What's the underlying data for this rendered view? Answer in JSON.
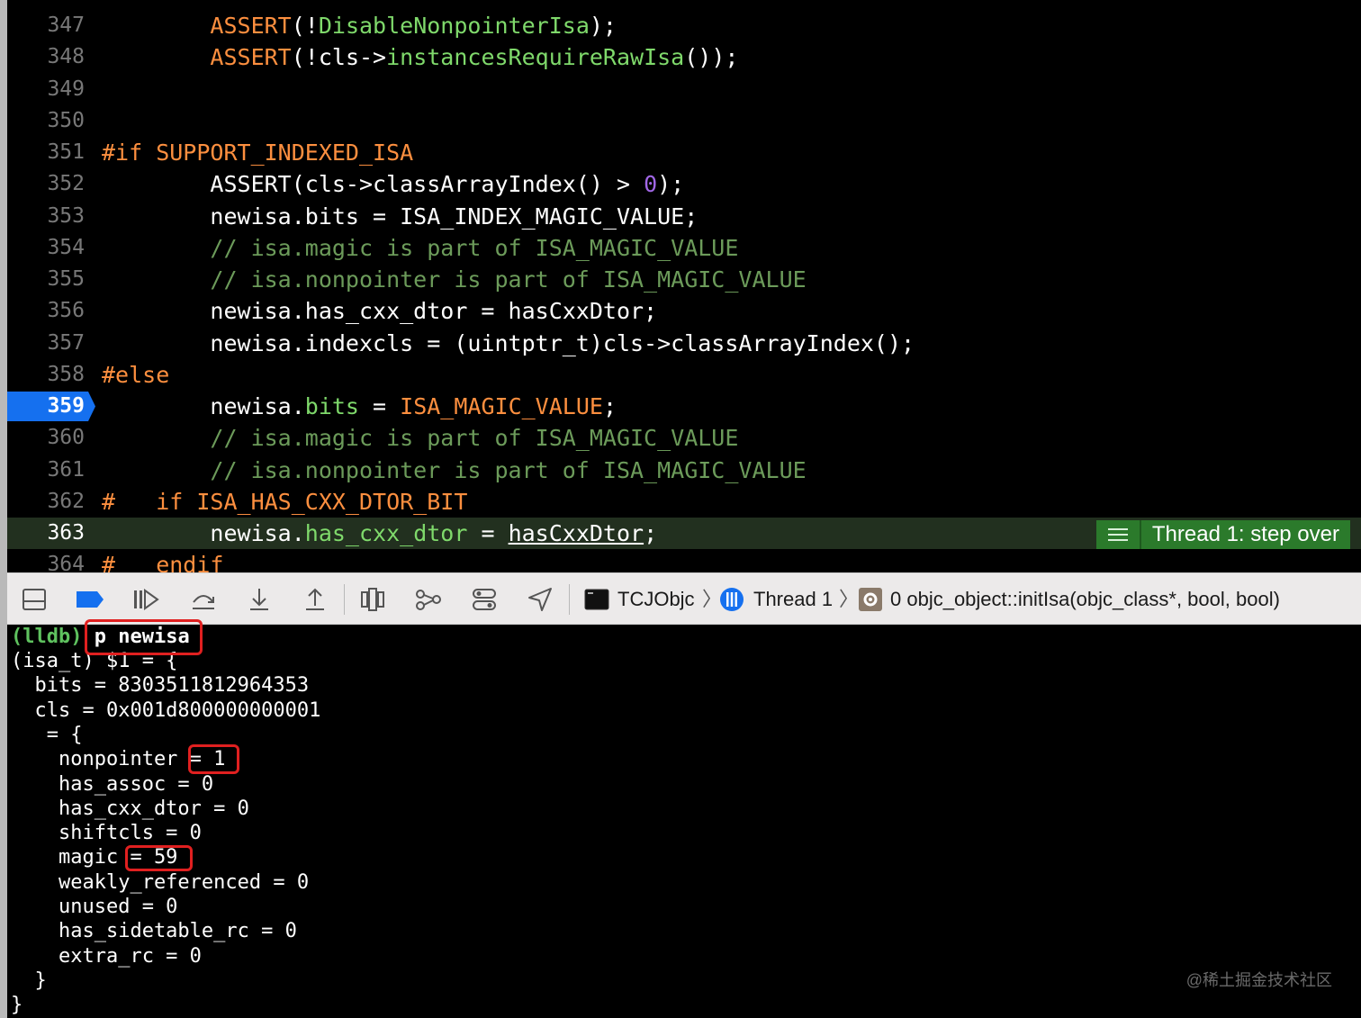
{
  "editor": {
    "lines": [
      {
        "num": "347",
        "segments": [
          {
            "t": "        ",
            "c": ""
          },
          {
            "t": "ASSERT",
            "c": "mac"
          },
          {
            "t": "(!",
            "c": ""
          },
          {
            "t": "DisableNonpointerIsa",
            "c": "grn"
          },
          {
            "t": ");",
            "c": ""
          }
        ]
      },
      {
        "num": "348",
        "segments": [
          {
            "t": "        ",
            "c": ""
          },
          {
            "t": "ASSERT",
            "c": "mac"
          },
          {
            "t": "(!cls->",
            "c": ""
          },
          {
            "t": "instancesRequireRawIsa",
            "c": "grn"
          },
          {
            "t": "());",
            "c": ""
          }
        ]
      },
      {
        "num": "349",
        "segments": []
      },
      {
        "num": "350",
        "segments": []
      },
      {
        "num": "351",
        "segments": [
          {
            "t": "#if SUPPORT_INDEXED_ISA",
            "c": "pp"
          }
        ]
      },
      {
        "num": "352",
        "segments": [
          {
            "t": "        ASSERT(cls->classArrayIndex() > ",
            "c": ""
          },
          {
            "t": "0",
            "c": "num"
          },
          {
            "t": ");",
            "c": ""
          }
        ]
      },
      {
        "num": "353",
        "segments": [
          {
            "t": "        newisa.bits = ISA_INDEX_MAGIC_VALUE;",
            "c": ""
          }
        ]
      },
      {
        "num": "354",
        "segments": [
          {
            "t": "        // isa.magic is part of ISA_MAGIC_VALUE",
            "c": "cm"
          }
        ]
      },
      {
        "num": "355",
        "segments": [
          {
            "t": "        // isa.nonpointer is part of ISA_MAGIC_VALUE",
            "c": "cm"
          }
        ]
      },
      {
        "num": "356",
        "segments": [
          {
            "t": "        newisa.has_cxx_dtor = hasCxxDtor;",
            "c": ""
          }
        ]
      },
      {
        "num": "357",
        "segments": [
          {
            "t": "        newisa.indexcls = (uintptr_t)cls->classArrayIndex();",
            "c": ""
          }
        ]
      },
      {
        "num": "358",
        "segments": [
          {
            "t": "#else",
            "c": "pp"
          }
        ]
      },
      {
        "num": "359",
        "breakpoint": true,
        "segments": [
          {
            "t": "        newisa.",
            "c": ""
          },
          {
            "t": "bits",
            "c": "grn"
          },
          {
            "t": " = ",
            "c": ""
          },
          {
            "t": "ISA_MAGIC_VALUE",
            "c": "mac"
          },
          {
            "t": ";",
            "c": ""
          }
        ]
      },
      {
        "num": "360",
        "segments": [
          {
            "t": "        // isa.magic is part of ISA_MAGIC_VALUE",
            "c": "cm"
          }
        ]
      },
      {
        "num": "361",
        "segments": [
          {
            "t": "        // isa.nonpointer is part of ISA_MAGIC_VALUE",
            "c": "cm"
          }
        ]
      },
      {
        "num": "362",
        "segments": [
          {
            "t": "#   if ISA_HAS_CXX_DTOR_BIT",
            "c": "pp"
          }
        ]
      },
      {
        "num": "363",
        "current": true,
        "segments": [
          {
            "t": "        newisa.",
            "c": ""
          },
          {
            "t": "has_cxx_dtor",
            "c": "grn"
          },
          {
            "t": " = ",
            "c": ""
          },
          {
            "t": "hasCxxDtor",
            "c": "ul"
          },
          {
            "t": ";",
            "c": ""
          }
        ]
      },
      {
        "num": "364",
        "segments": [
          {
            "t": "#   endif",
            "c": "pp"
          }
        ]
      }
    ],
    "thread_status": "Thread 1: step over"
  },
  "debug_bar": {
    "buttons": [
      "hide-debug-area-icon",
      "breakpoints-toggle-icon",
      "continue-icon",
      "step-over-icon",
      "step-into-icon",
      "step-out-icon",
      "view-hierarchy-icon",
      "memory-graph-icon",
      "environment-overrides-icon",
      "simulate-location-icon"
    ],
    "breadcrumbs": {
      "target": "TCJObjc",
      "thread": "Thread 1",
      "frame": "0 objc_object::initIsa(objc_class*, bool, bool)"
    }
  },
  "console": {
    "prompt": "(lldb)",
    "command": "p newisa",
    "output": [
      "(isa_t) $1 = {",
      "  bits = 8303511812964353",
      "  cls = 0x001d800000000001",
      "   = {",
      "    nonpointer = 1",
      "    has_assoc = 0",
      "    has_cxx_dtor = 0",
      "    shiftcls = 0",
      "    magic = 59",
      "    weakly_referenced = 0",
      "    unused = 0",
      "    has_sidetable_rc = 0",
      "    extra_rc = 0",
      "  }",
      "}"
    ],
    "highlighted_lines": [
      "command",
      "nonpointer",
      "magic"
    ]
  },
  "watermark": "@稀土掘金技术社区",
  "colors": {
    "breakpoint": "#1570ef",
    "thread_badge": "#2b7a2b",
    "highlight_box": "#e02020",
    "lldb_prompt": "#5fc25f"
  }
}
